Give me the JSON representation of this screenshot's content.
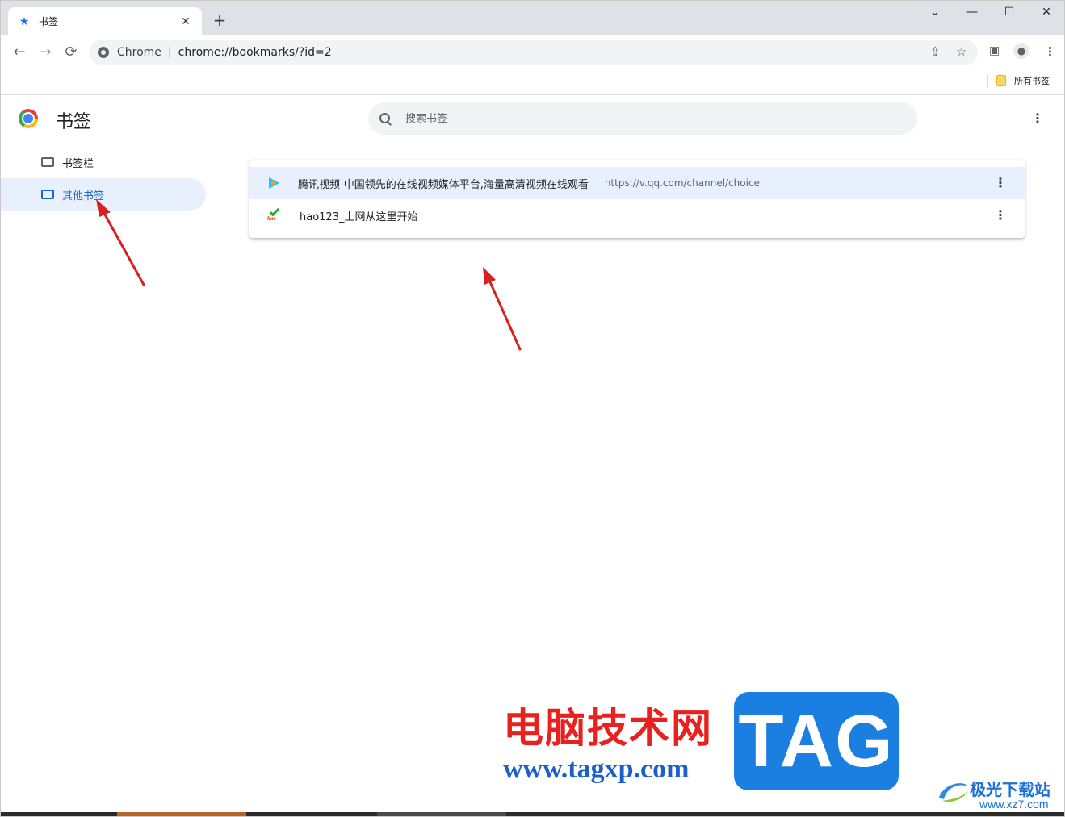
{
  "tab": {
    "title": "书签",
    "icon": "star-icon"
  },
  "window_controls": {
    "dropdown": "⌄",
    "minimize": "—",
    "maximize": "☐",
    "close": "✕"
  },
  "toolbar": {
    "back": "←",
    "forward": "→",
    "reload": "⟳",
    "chip": "Chrome",
    "separator": "|",
    "url": "chrome://bookmarks/?id=2"
  },
  "bookmarks_bar": {
    "all_bookmarks": "所有书签"
  },
  "manager": {
    "title": "书签",
    "search_placeholder": "搜索书签"
  },
  "sidebar": {
    "items": [
      {
        "label": "书签栏",
        "active": false
      },
      {
        "label": "其他书签",
        "active": true
      }
    ]
  },
  "bookmarks": [
    {
      "title": "腾讯视频-中国领先的在线视频媒体平台,海量高清视频在线观看",
      "url": "https://v.qq.com/channel/choice",
      "icon": "tencent-video-icon"
    },
    {
      "title": "hao123_上网从这里开始",
      "url": "",
      "icon": "hao123-icon"
    }
  ],
  "favicon_text": {
    "hao": "hao"
  },
  "watermark": {
    "site_name": "电脑技术网",
    "site_url": "www.tagxp.com",
    "tag": "TAG",
    "brand": "极光下载站",
    "brand_url": "www.xz7.com"
  },
  "colors": {
    "accent": "#1a73e8",
    "selected_bg": "#e8f0fe",
    "arrow": "#d92020"
  }
}
